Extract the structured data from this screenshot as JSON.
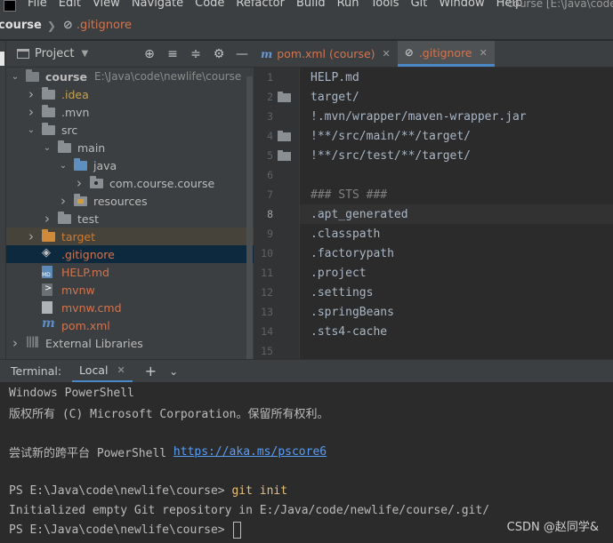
{
  "menu": {
    "items": [
      "File",
      "Edit",
      "View",
      "Navigate",
      "Code",
      "Refactor",
      "Build",
      "Run",
      "Tools",
      "Git",
      "Window",
      "Help"
    ],
    "window_title": "course [E:\\Java\\code\\"
  },
  "navbar": {
    "project": "course",
    "file": ".gitignore"
  },
  "project_panel": {
    "title": "Project",
    "tree": [
      {
        "label": "course",
        "path": "E:\\Java\\code\\newlife\\course",
        "depth": 0,
        "arrow": "down",
        "icon": "folder-dark"
      },
      {
        "label": ".idea",
        "depth": 1,
        "arrow": "right",
        "icon": "folder",
        "color": "#c7a24f"
      },
      {
        "label": ".mvn",
        "depth": 1,
        "arrow": "right",
        "icon": "folder",
        "color": "#bbbbbb"
      },
      {
        "label": "src",
        "depth": 1,
        "arrow": "down",
        "icon": "folder",
        "color": "#bbbbbb"
      },
      {
        "label": "main",
        "depth": 2,
        "arrow": "down",
        "icon": "folder",
        "color": "#bbbbbb"
      },
      {
        "label": "java",
        "depth": 3,
        "arrow": "down",
        "icon": "folder-blue",
        "color": "#bbbbbb"
      },
      {
        "label": "com.course.course",
        "depth": 4,
        "arrow": "right",
        "icon": "folder-pkg",
        "color": "#bbbbbb"
      },
      {
        "label": "resources",
        "depth": 3,
        "arrow": "right",
        "icon": "folder-res",
        "color": "#bbbbbb"
      },
      {
        "label": "test",
        "depth": 2,
        "arrow": "right",
        "icon": "folder",
        "color": "#bbbbbb"
      },
      {
        "label": "target",
        "depth": 1,
        "arrow": "right",
        "icon": "folder-orange",
        "color": "#cf7a2e",
        "highlight": "brown"
      },
      {
        "label": ".gitignore",
        "depth": 1,
        "arrow": "",
        "icon": "file-git",
        "color": "#d2744e",
        "highlight": "blue"
      },
      {
        "label": "HELP.md",
        "depth": 1,
        "arrow": "",
        "icon": "file-md",
        "color": "#d2744e"
      },
      {
        "label": "mvnw",
        "depth": 1,
        "arrow": "",
        "icon": "file-term",
        "color": "#d2744e"
      },
      {
        "label": "mvnw.cmd",
        "depth": 1,
        "arrow": "",
        "icon": "file-plain",
        "color": "#d2744e"
      },
      {
        "label": "pom.xml",
        "depth": 1,
        "arrow": "",
        "icon": "maven",
        "color": "#d2744e"
      },
      {
        "label": "External Libraries",
        "depth": 0,
        "arrow": "right",
        "icon": "library",
        "color": "#bbbbbb"
      }
    ]
  },
  "editor": {
    "tabs": [
      {
        "label": "pom.xml (course)",
        "icon": "m",
        "active": false
      },
      {
        "label": ".gitignore",
        "icon": "git",
        "active": true
      }
    ],
    "lines": [
      {
        "n": "1",
        "text": "HELP.md",
        "fold": false,
        "type": "code"
      },
      {
        "n": "2",
        "text": "target/",
        "fold": true,
        "type": "code"
      },
      {
        "n": "3",
        "text": "!.mvn/wrapper/maven-wrapper.jar",
        "fold": false,
        "type": "code"
      },
      {
        "n": "4",
        "text": "!**/src/main/**/target/",
        "fold": true,
        "type": "code"
      },
      {
        "n": "5",
        "text": "!**/src/test/**/target/",
        "fold": true,
        "type": "code"
      },
      {
        "n": "6",
        "text": "",
        "fold": false,
        "type": "code"
      },
      {
        "n": "7",
        "text": "### STS ###",
        "fold": false,
        "type": "comment"
      },
      {
        "n": "8",
        "text": ".apt_generated",
        "fold": false,
        "type": "code",
        "current": true
      },
      {
        "n": "9",
        "text": ".classpath",
        "fold": false,
        "type": "code"
      },
      {
        "n": "10",
        "text": ".factorypath",
        "fold": false,
        "type": "code"
      },
      {
        "n": "11",
        "text": ".project",
        "fold": false,
        "type": "code"
      },
      {
        "n": "12",
        "text": ".settings",
        "fold": false,
        "type": "code"
      },
      {
        "n": "13",
        "text": ".springBeans",
        "fold": false,
        "type": "code"
      },
      {
        "n": "14",
        "text": ".sts4-cache",
        "fold": false,
        "type": "code"
      },
      {
        "n": "15",
        "text": "",
        "fold": false,
        "type": "code"
      }
    ]
  },
  "terminal": {
    "title": "Terminal:",
    "tab": "Local",
    "lines": [
      {
        "text": "Windows PowerShell"
      },
      {
        "text": "版权所有 (C) Microsoft Corporation。保留所有权利。"
      },
      {
        "text": ""
      },
      {
        "text": "尝试新的跨平台 PowerShell ",
        "link": "https://aka.ms/pscore6"
      },
      {
        "text": ""
      },
      {
        "text": "PS E:\\Java\\code\\newlife\\course> ",
        "cmd": "git init"
      },
      {
        "text": "Initialized empty Git repository in E:/Java/code/newlife/course/.git/"
      },
      {
        "text": "PS E:\\Java\\code\\newlife\\course> ",
        "cursor": true
      }
    ]
  },
  "watermark": "CSDN @赵同学&"
}
